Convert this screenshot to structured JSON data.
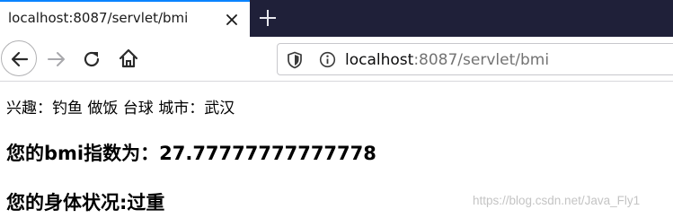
{
  "browser": {
    "tab": {
      "title": "localhost:8087/servlet/bmi"
    },
    "url": {
      "host": "localhost",
      "rest": ":8087/servlet/bmi"
    },
    "icons": {
      "close": "close-icon",
      "new_tab": "plus-icon",
      "back": "arrow-left-icon",
      "forward": "arrow-right-icon",
      "reload": "reload-icon",
      "home": "home-icon",
      "shield": "shield-icon",
      "info": "info-icon"
    },
    "colors": {
      "tab_strip": "#1f2039",
      "tab_accent": "#0a84ff"
    }
  },
  "page": {
    "hobbies_line": "兴趣：钓鱼 做饭 台球 城市：武汉",
    "bmi_line": "您的bmi指数为：27.77777777777778",
    "status_line": "您的身体状况:过重",
    "watermark": "https://blog.csdn.net/Java_Fly1"
  }
}
